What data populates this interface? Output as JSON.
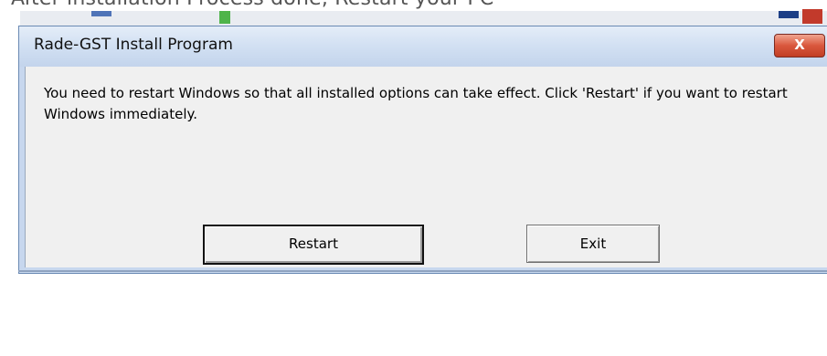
{
  "caption": "After installation Process done, Restart your PC",
  "dialog": {
    "title": "Rade-GST Install Program",
    "close_label": "X",
    "message": "You need to restart Windows so that all installed options can take effect. Click 'Restart' if you want to restart Windows immediately.",
    "buttons": {
      "restart": "Restart",
      "exit": "Exit"
    }
  },
  "colors": {
    "titlebar": "#d3e1f3",
    "close_button": "#d9573d",
    "client_background": "#f0f0f0"
  },
  "icons": {
    "close": "close-icon"
  }
}
